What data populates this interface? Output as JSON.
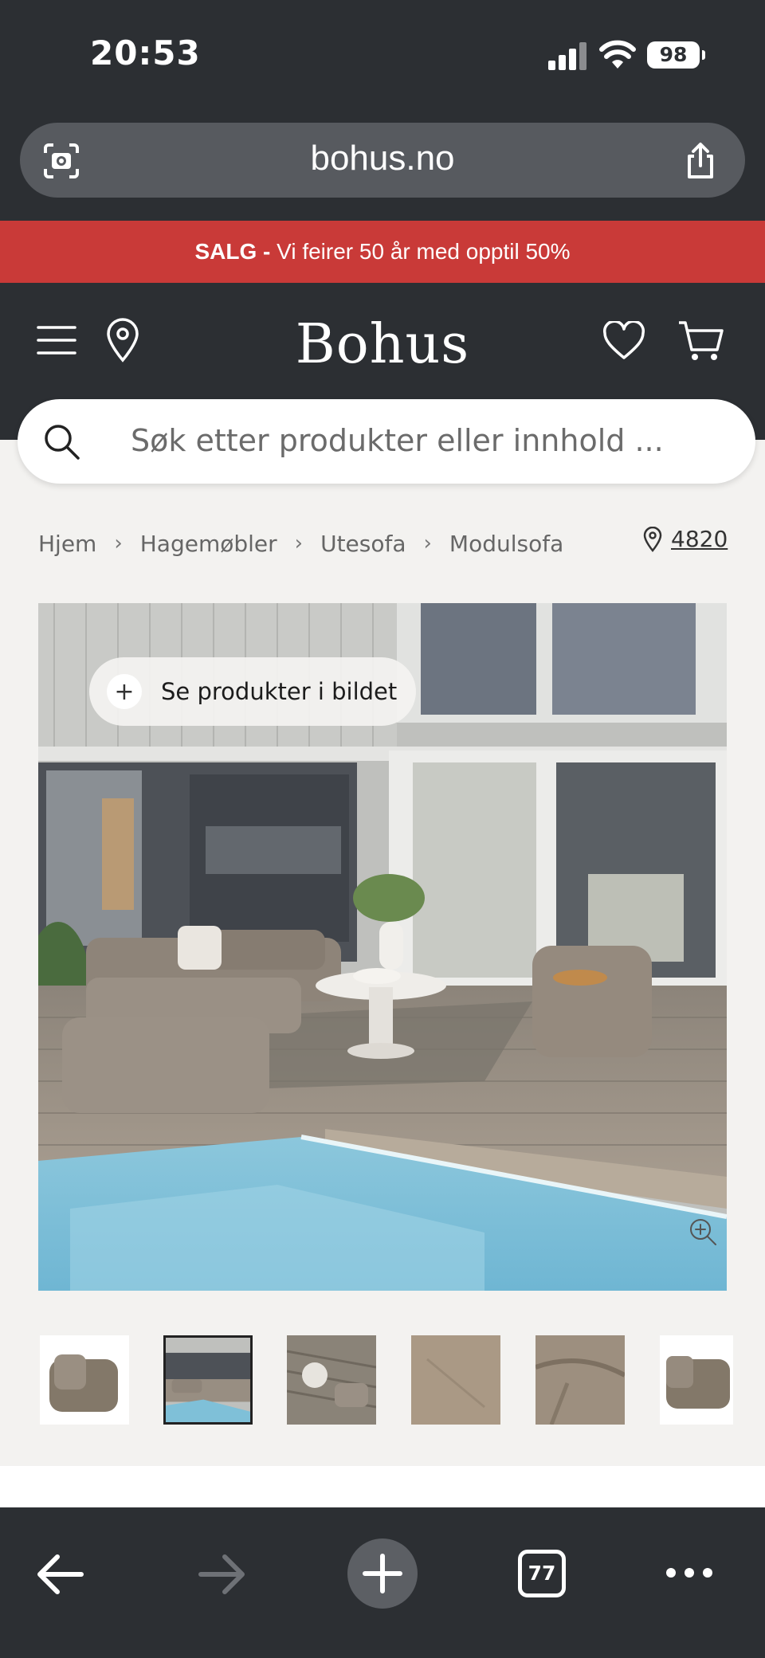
{
  "status": {
    "time": "20:53",
    "battery": "98"
  },
  "browser": {
    "url": "bohus.no",
    "tab_count": "77"
  },
  "promo": {
    "bold": "SALG -",
    "text": " Vi feirer 50 år med opptil 50%"
  },
  "header": {
    "logo": "Bohus"
  },
  "search": {
    "placeholder": "Søk etter produkter eller innhold ..."
  },
  "breadcrumb": [
    "Hjem",
    "Hagemøbler",
    "Utesofa",
    "Modulsofa"
  ],
  "store": {
    "code": "4820"
  },
  "hero": {
    "hotspot_label": "Se produkter i bildet"
  },
  "thumbnails": {
    "count": 6,
    "active_index": 1
  },
  "colors": {
    "promo": "#c93a38",
    "header": "#2c2f33",
    "page_bg": "#f3f2f0"
  }
}
